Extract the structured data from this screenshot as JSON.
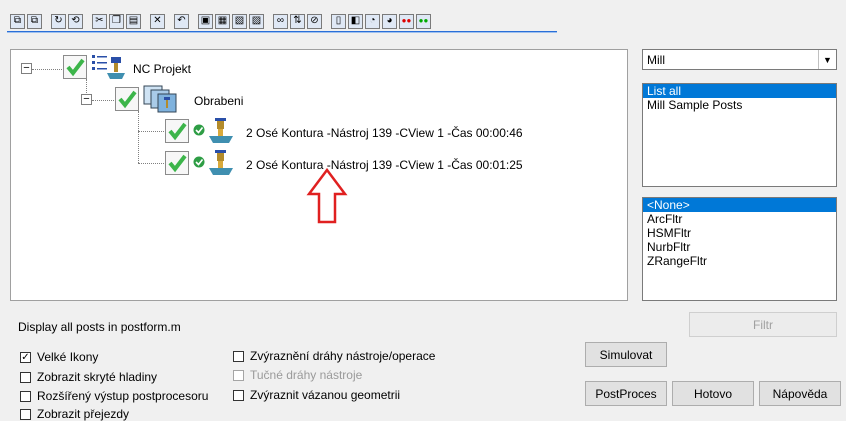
{
  "tree": {
    "root": {
      "label": "NC Projekt",
      "expanded": true
    },
    "group": {
      "label": "Obrabeni",
      "expanded": true
    },
    "operations": [
      {
        "label": "2 Osé Kontura -Nástroj 139 -CView 1 -Čas 00:00:46"
      },
      {
        "label": "2 Osé Kontura -Nástroj 139 -CView 1 -Čas 00:01:25"
      }
    ]
  },
  "machine_select": {
    "value": "Mill"
  },
  "posts_list": {
    "items": [
      "List all",
      "Mill Sample Posts"
    ],
    "selected_index": 0
  },
  "filters_list": {
    "items": [
      "<None>",
      "ArcFltr",
      "HSMFltr",
      "NurbFltr",
      "ZRangeFltr"
    ],
    "selected_index": 0
  },
  "status_text": "Display all posts in postform.m",
  "buttons": {
    "filtr": "Filtr",
    "simulovat": "Simulovat",
    "postproces": "PostProces",
    "hotovo": "Hotovo",
    "napoveda": "Nápověda"
  },
  "checkboxes": {
    "velke_ikony": {
      "label": "Velké Ikony",
      "checked": true
    },
    "skryte_hladiny": {
      "label": "Zobrazit skryté hladiny",
      "checked": false
    },
    "rozsireny_vystup": {
      "label": "Rozšířený výstup postprocesoru",
      "checked": false
    },
    "prejezdy": {
      "label": "Zobrazit přejezdy",
      "checked": false
    },
    "zvyrazneni_drahy": {
      "label": "Zvýraznění dráhy nástroje/operace",
      "checked": false
    },
    "tucne_drahy": {
      "label": "Tučné dráhy nástroje",
      "checked": false,
      "disabled": true
    },
    "vazana_geometrie": {
      "label": "Zvýraznit vázanou geometrii",
      "checked": false
    }
  },
  "colors": {
    "selection": "#0078d7",
    "check_green": "#3cb54a",
    "arrow_red": "#e02020"
  }
}
